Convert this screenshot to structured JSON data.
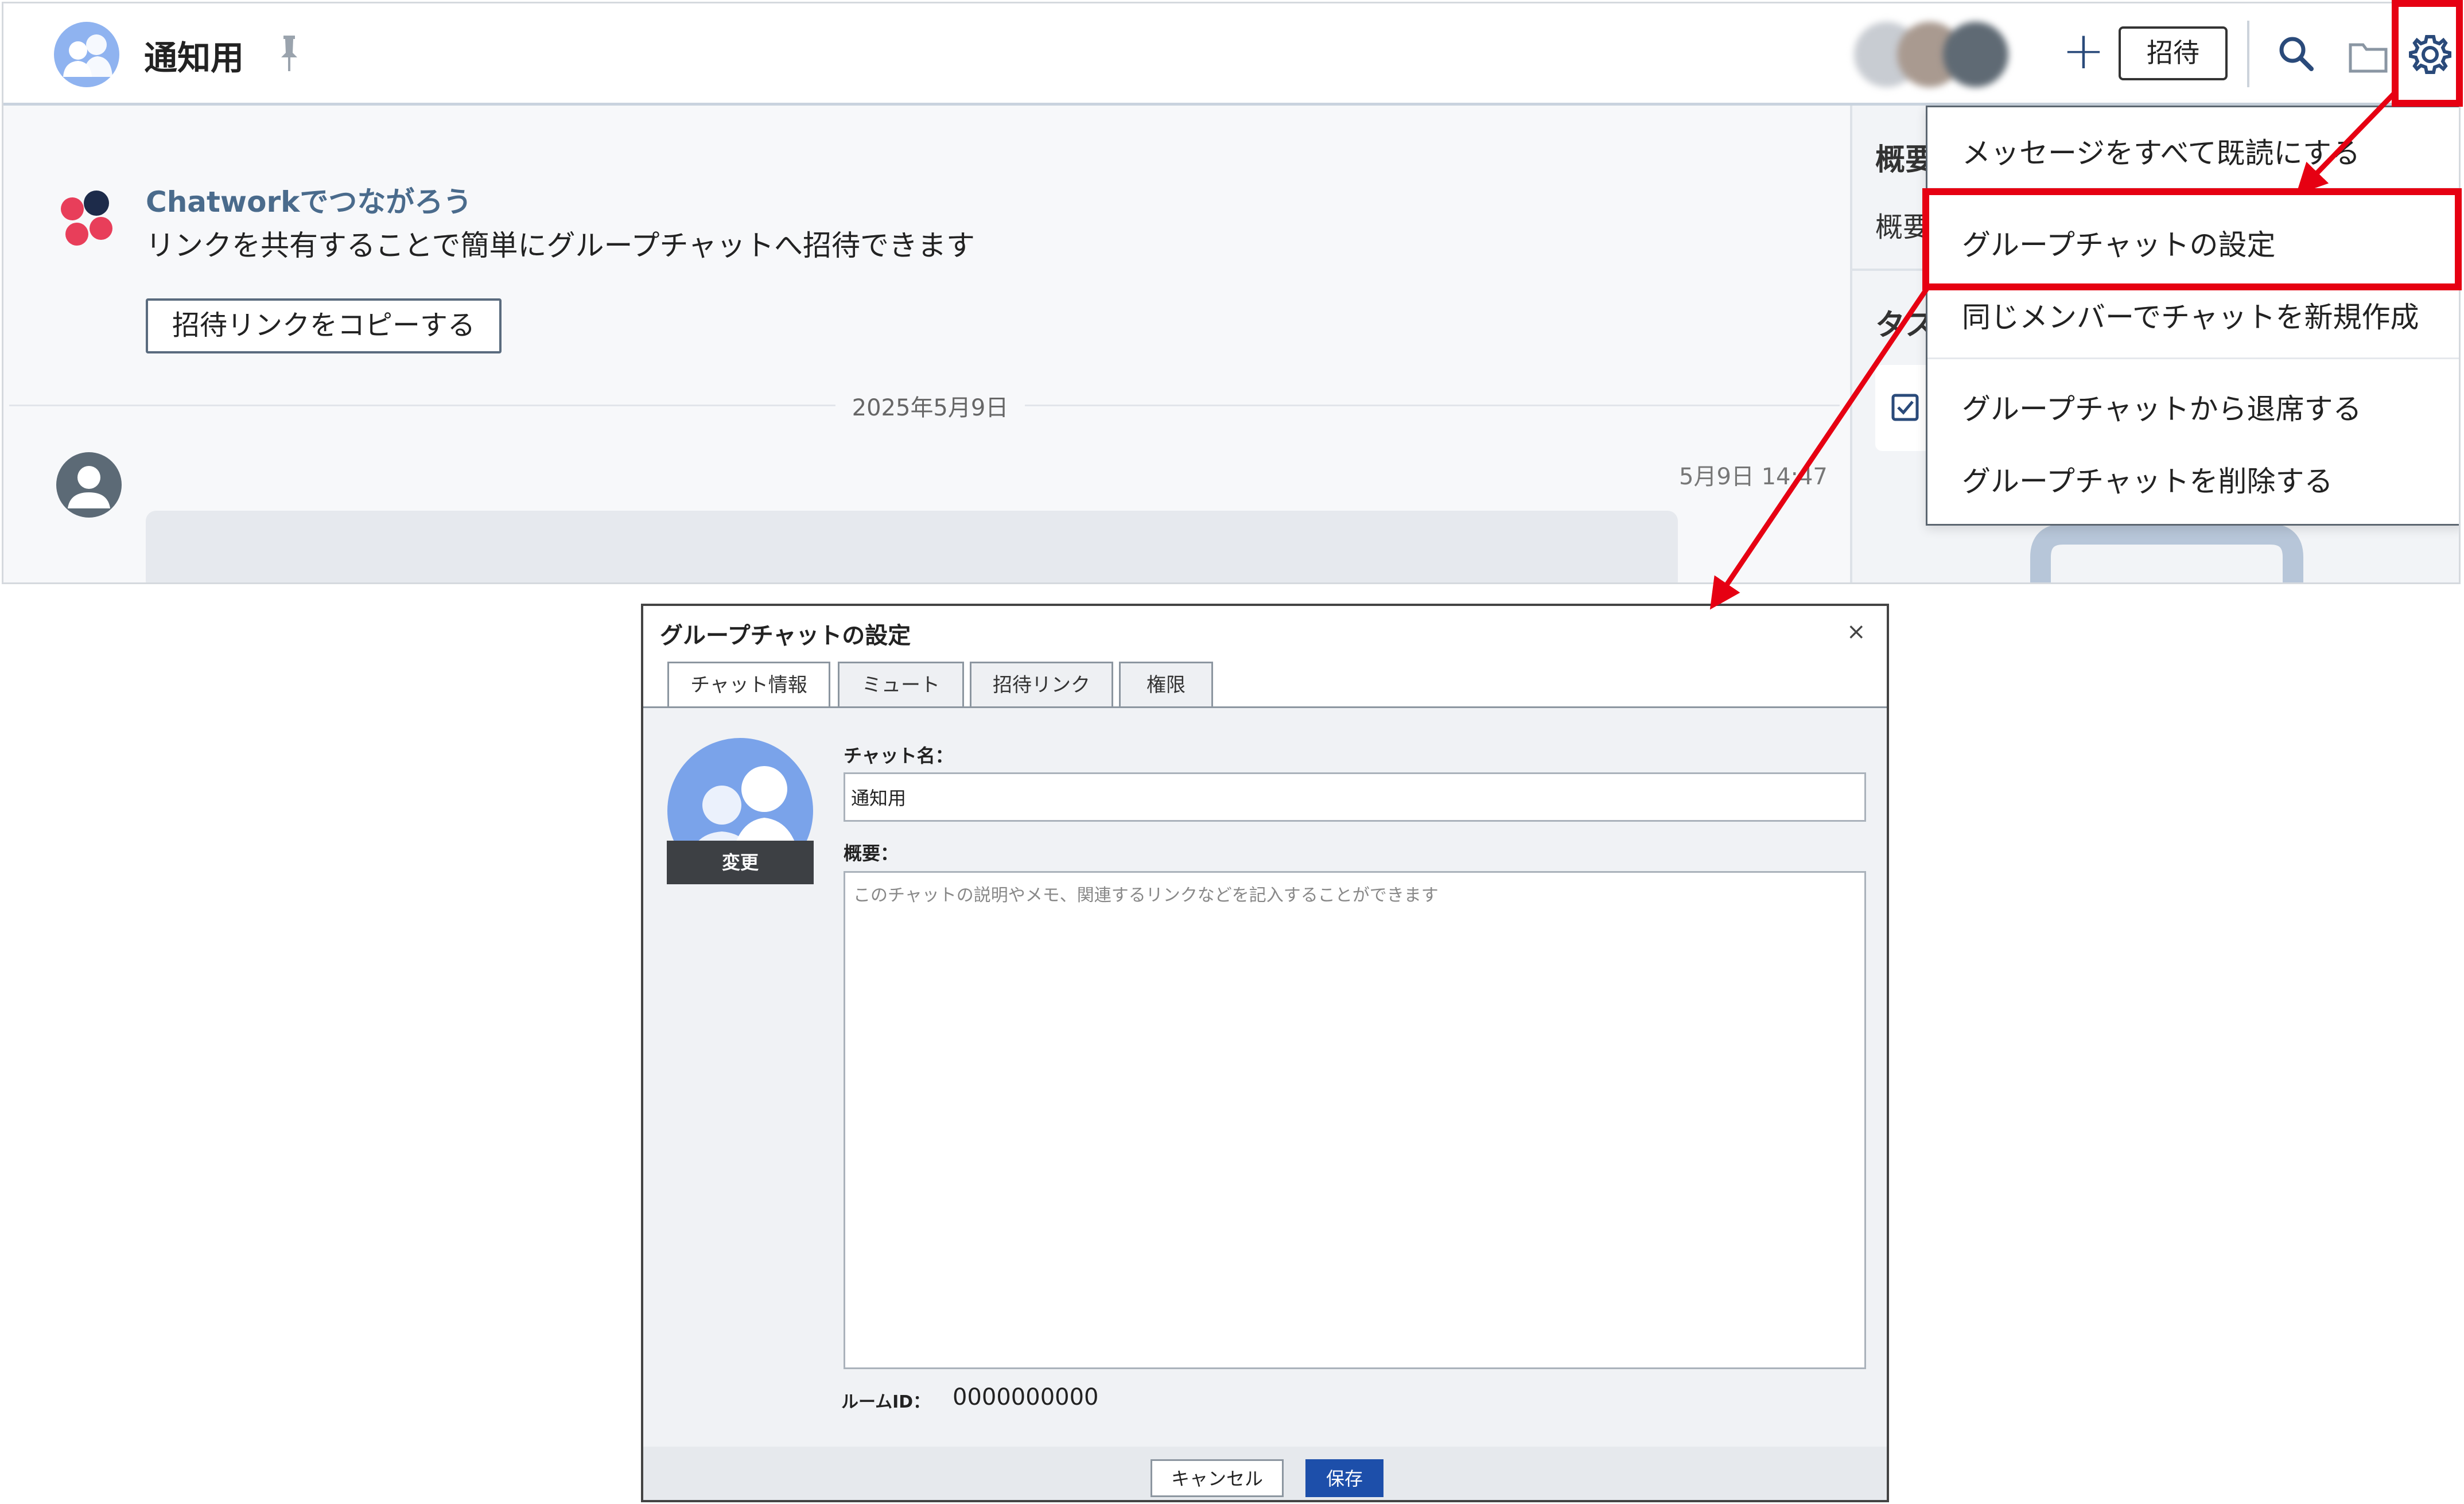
{
  "header": {
    "room_title": "通知用",
    "invite_label": "招待",
    "plus_label": "+"
  },
  "chat": {
    "promo_title": "Chatworkでつながろう",
    "promo_desc": "リンクを共有することで簡単にグループチャットへ招待できます",
    "copy_link_label": "招待リンクをコピーする",
    "date_separator": "2025年5月9日",
    "message_time": "5月9日 14:47"
  },
  "right_panel": {
    "overview_heading": "概要",
    "overview_text": "概要",
    "task_heading": "タス"
  },
  "menu": {
    "items": [
      "メッセージをすべて既読にする",
      "グループチャットの設定",
      "同じメンバーでチャットを新規作成",
      "グループチャットから退席する",
      "グループチャットを削除する"
    ]
  },
  "dialog": {
    "title": "グループチャットの設定",
    "close_label": "×",
    "tabs": [
      "チャット情報",
      "ミュート",
      "招待リンク",
      "権限"
    ],
    "change_label": "変更",
    "name_label": "チャット名：",
    "name_value": "通知用",
    "desc_label": "概要：",
    "desc_placeholder": "このチャットの説明やメモ、関連するリンクなどを記入することができます",
    "room_id_label": "ルームID：",
    "room_id_value": "0000000000",
    "cancel_label": "キャンセル",
    "save_label": "保存"
  },
  "colors": {
    "annotation_red": "#e60012",
    "save_blue": "#1d4faa",
    "promo_title": "#4a6b8c"
  }
}
